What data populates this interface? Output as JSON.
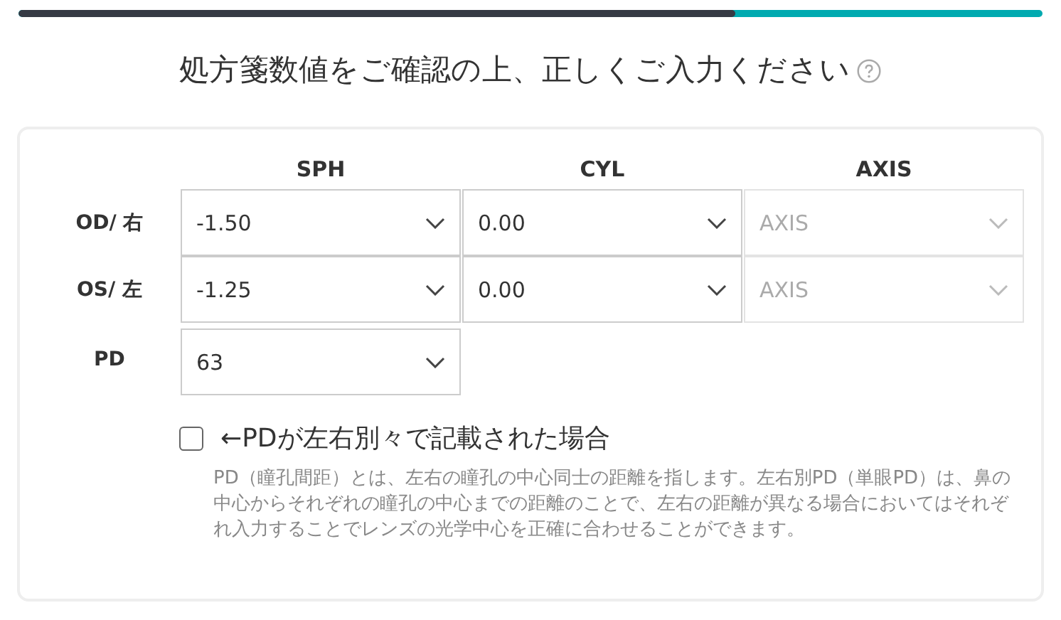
{
  "progress": {
    "level": 0.7
  },
  "title": "処方箋数値をご確認の上、正しくご入力ください",
  "columns": [
    "SPH",
    "CYL",
    "AXIS"
  ],
  "rows": [
    {
      "label": "OD/ 右",
      "fields": [
        {
          "value": "-1.50",
          "disabled": false
        },
        {
          "value": "0.00",
          "disabled": false
        },
        {
          "placeholder": "AXIS",
          "disabled": true
        }
      ]
    },
    {
      "label": "OS/ 左",
      "fields": [
        {
          "value": "-1.25",
          "disabled": false
        },
        {
          "value": "0.00",
          "disabled": false
        },
        {
          "placeholder": "AXIS",
          "disabled": true
        }
      ]
    },
    {
      "label": "PD",
      "fields": [
        {
          "value": "63",
          "disabled": false
        }
      ]
    }
  ],
  "separate_pd": {
    "label": "←PDが左右別々で記載された場合",
    "checked": false
  },
  "description": "PD（瞳孔間距）とは、左右の瞳孔の中心同士の距離を指します。左右別PD（単眼PD）は、鼻の中心からそれぞれの瞳孔の中心までの距離のことで、左右の距離が異なる場合においてはそれぞれ入力することでレンズの光学中心を正確に合わせることができます。"
}
